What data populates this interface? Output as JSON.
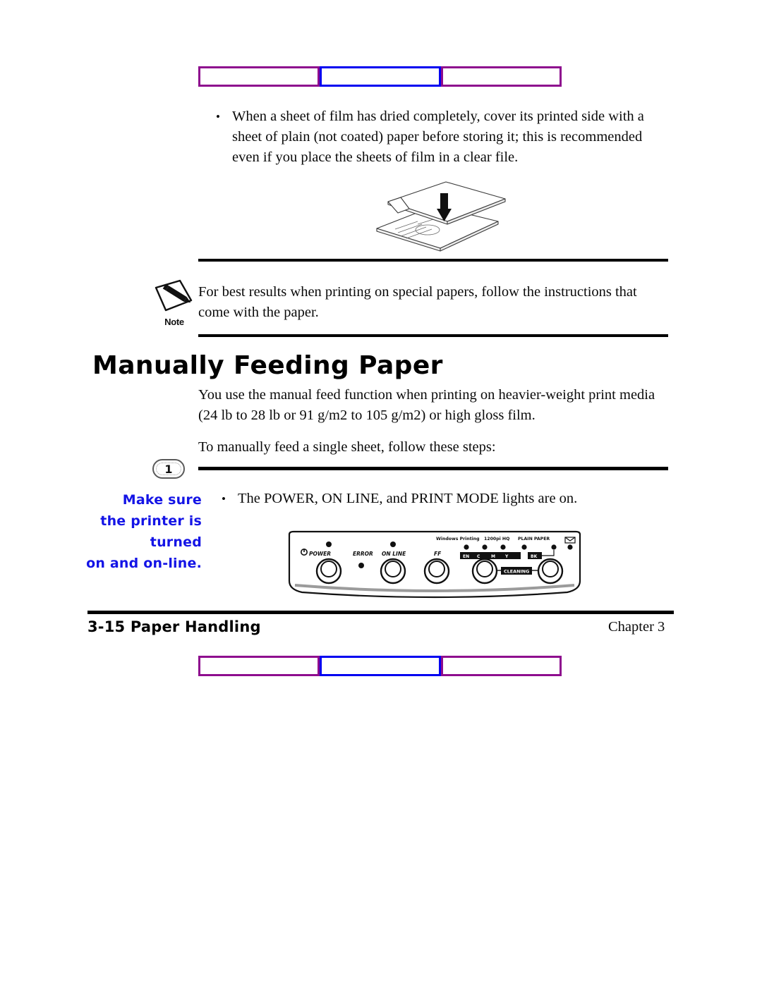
{
  "document": {
    "type": "printer-user-manual-page",
    "page_label": "3-15",
    "section_name": "Paper Handling",
    "chapter_label": "Chapter 3"
  },
  "deco_bar": {
    "segments": [
      {
        "name": "segment-left",
        "color": "#8e0d8e"
      },
      {
        "name": "segment-middle",
        "color": "#0000f0"
      },
      {
        "name": "segment-right",
        "color": "#8e0d8e"
      }
    ]
  },
  "film_bullet": {
    "bullet": "•",
    "text": "When a sheet of film has dried completely, cover its printed side with a sheet of plain (not coated) paper before storing it; this is recommended even if you place the sheets of film in a clear file."
  },
  "film_figure": {
    "caption": "",
    "alt": "Illustration of a plain sheet of paper being laid down over a printed sheet of film, with a downward arrow."
  },
  "note": {
    "icon_label": "Note",
    "text": "For best results when printing on special papers, follow the instructions that come with the paper."
  },
  "heading": {
    "title": "Manually Feeding Paper"
  },
  "intro": {
    "paragraph_1": "You use the manual feed function when printing on heavier-weight print media (24 lb to 28 lb or 91 g/m2 to 105 g/m2) or high gloss film.",
    "paragraph_2": "To manually feed a single sheet, follow these steps:"
  },
  "step": {
    "number": "1",
    "bullet": "•",
    "text": "The POWER, ON LINE, and PRINT MODE lights are on."
  },
  "margin_note": {
    "lines": [
      "Make sure",
      "the printer is",
      "turned",
      "on and on-line."
    ],
    "color": "#1414e6"
  },
  "control_panel_figure": {
    "alt": "Illustration of the printer control panel with indicator lights and round buttons.",
    "button_labels": [
      "POWER",
      "ERROR",
      "ON LINE",
      "FF"
    ],
    "indicator_groups": [
      "Windows Printing",
      "1200pi HQ",
      "PLAIN PAPER"
    ],
    "mode_cells": [
      "EN",
      "C",
      "M",
      "Y",
      "BK"
    ],
    "cleaning_label": "CLEANING"
  },
  "footer": {
    "left": "3-15 Paper Handling",
    "right": "Chapter 3"
  }
}
